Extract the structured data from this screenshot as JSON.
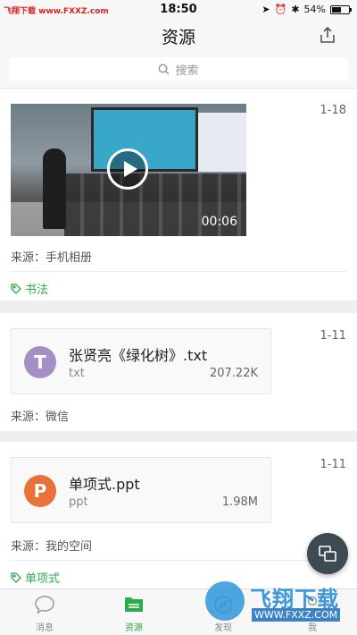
{
  "status_bar": {
    "watermark": "飞翔下载 www.FXXZ.com",
    "time": "18:50",
    "battery": "54%"
  },
  "header": {
    "title": "资源",
    "upload_icon": "upload-icon"
  },
  "search": {
    "placeholder": "搜索",
    "icon": "search-icon"
  },
  "cards": [
    {
      "date": "1-18",
      "type": "video",
      "duration": "00:06",
      "source": "来源：手机相册",
      "tag": "书法"
    },
    {
      "date": "1-11",
      "type": "file",
      "icon_letter": "T",
      "icon_color": "#a58fc4",
      "file_name": "张贤亮《绿化树》.txt",
      "file_type": "txt",
      "file_size": "207.22K",
      "source": "来源：微信"
    },
    {
      "date": "1-11",
      "type": "file",
      "icon_letter": "P",
      "icon_color": "#e8733a",
      "file_name": "单项式.ppt",
      "file_type": "ppt",
      "file_size": "1.98M",
      "source": "来源：我的空间",
      "tag": "单项式"
    }
  ],
  "tabs": [
    {
      "label": "消息",
      "icon": "chat-bubble-icon"
    },
    {
      "label": "资源",
      "icon": "folder-icon",
      "active": true
    },
    {
      "label": "发现",
      "icon": "compass-icon"
    },
    {
      "label": "我",
      "icon": "person-icon"
    }
  ],
  "watermark": {
    "text": "飞翔下载",
    "url": "WWW.FXXZ.COM"
  },
  "colors": {
    "accent": "#2ea94b",
    "fab": "#3e4a52"
  }
}
